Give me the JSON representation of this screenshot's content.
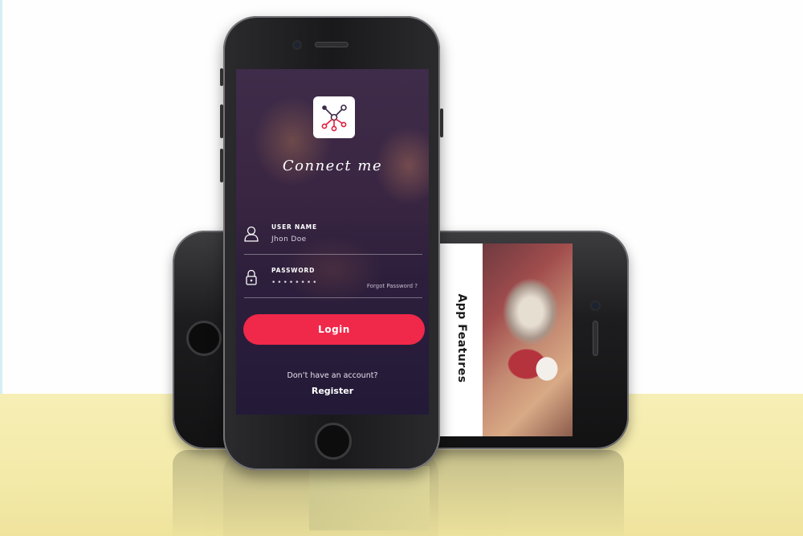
{
  "app": {
    "title": "Connect me",
    "logo_icon": "network-nodes-icon",
    "accent_color": "#f0284a"
  },
  "login_form": {
    "username": {
      "label": "USER NAME",
      "value": "Jhon Doe",
      "icon": "user-icon"
    },
    "password": {
      "label": "PASSWORD",
      "value": "••••••••",
      "icon": "lock-icon",
      "forgot_link": "Forgot Password ?"
    },
    "login_button": "Login",
    "no_account_text": "Don’t have an account?",
    "register_link": "Register"
  },
  "secondary_screen": {
    "heading": "App Features"
  },
  "colors": {
    "screen_bg_top": "#3e2c4a",
    "screen_bg_bottom": "#231a38",
    "floor": "#f3eaa9"
  }
}
